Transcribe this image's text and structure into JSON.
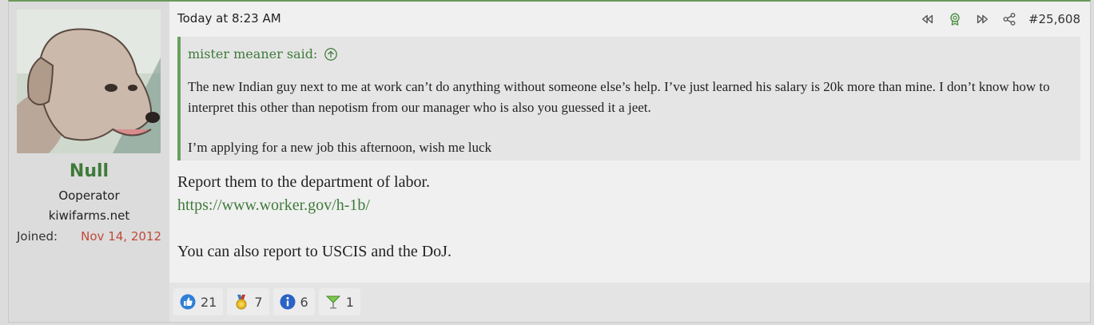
{
  "user": {
    "name": "Null",
    "title": "Ooperator",
    "site": "kiwifarms.net",
    "joined_label": "Joined:",
    "joined_value": "Nov 14, 2012"
  },
  "post": {
    "timestamp": "Today at 8:23 AM",
    "number": "#25,608",
    "quote": {
      "author": "mister meaner said:",
      "paragraphs": [
        "The new Indian guy next to me at work can’t do anything without someone else’s help. I’ve just learned his salary is 20k more than mine. I don’t know how to interpret this other than nepotism from our manager who is also you guessed it a jeet.",
        "I’m applying for a new job this afternoon, wish me luck"
      ]
    },
    "body": {
      "line1": "Report them to the department of labor.",
      "link": "https://www.worker.gov/h-1b/",
      "line2": "You can also report to USCIS and the DoJ."
    }
  },
  "reactions": [
    {
      "icon": "thumbs-up-icon",
      "count": "21"
    },
    {
      "icon": "medal-icon",
      "count": "7"
    },
    {
      "icon": "info-icon",
      "count": "6"
    },
    {
      "icon": "cocktail-icon",
      "count": "1"
    }
  ],
  "colors": {
    "accent": "#3f7a3a",
    "joined": "#c04a3a"
  }
}
